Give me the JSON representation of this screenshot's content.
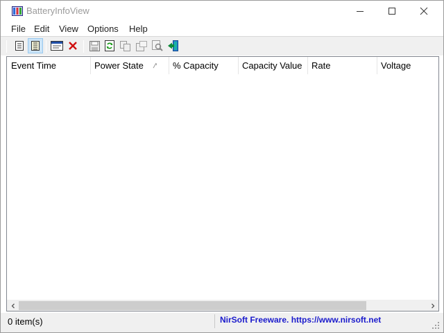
{
  "window": {
    "title": "BatteryInfoView"
  },
  "menu": {
    "items": [
      "File",
      "Edit",
      "View",
      "Options",
      "Help"
    ]
  },
  "toolbar": {
    "icons": [
      "properties-icon",
      "advanced-icon",
      "html-report-icon",
      "delete-icon",
      "save-icon",
      "refresh-icon",
      "copy-icon",
      "options-icon",
      "find-icon",
      "exit-icon"
    ]
  },
  "table": {
    "columns": [
      "Event Time",
      "Power State",
      "% Capacity",
      "Capacity Value",
      "Rate",
      "Voltage"
    ],
    "sorted_column": "Power State",
    "rows": []
  },
  "status": {
    "items_count": "0 item(s)",
    "link_text": "NirSoft Freeware. https://www.nirsoft.net"
  },
  "colors": {
    "link": "#1a1acc",
    "toolbar_bg": "#f0f0f0",
    "title_text": "#9b9b9b"
  }
}
